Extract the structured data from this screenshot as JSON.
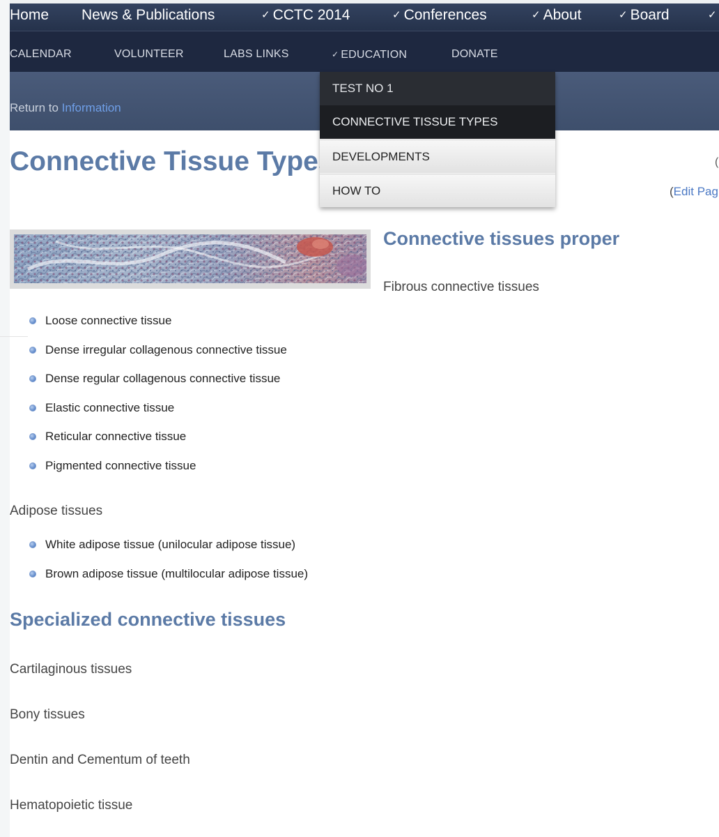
{
  "top_nav": {
    "items": [
      {
        "label": "Home",
        "chevron": false
      },
      {
        "label": "News & Publications",
        "chevron": false
      },
      {
        "label": "CCTC 2014",
        "chevron": true
      },
      {
        "label": "Conferences",
        "chevron": true
      },
      {
        "label": "About",
        "chevron": true
      },
      {
        "label": "Board",
        "chevron": true
      }
    ]
  },
  "sub_nav": {
    "items": [
      {
        "label": "CALENDAR"
      },
      {
        "label": "VOLUNTEER"
      },
      {
        "label": "LABS LINKS"
      },
      {
        "label": "EDUCATION",
        "chevron": true
      },
      {
        "label": "DONATE"
      }
    ]
  },
  "dropdown": {
    "items": [
      {
        "label": "TEST NO 1"
      },
      {
        "label": "CONNECTIVE TISSUE TYPES"
      },
      {
        "label": "DEVELOPMENTS"
      },
      {
        "label": "HOW TO"
      }
    ]
  },
  "breadcrumb": {
    "prefix": "Return to ",
    "link": "Information"
  },
  "page": {
    "title": "Connective Tissue Types",
    "edit_open": "(",
    "edit_link": "Edit Pag"
  },
  "content": {
    "proper_heading": "Connective tissues proper",
    "fibrous_label": "Fibrous connective tissues",
    "fibrous_list": [
      "Loose connective tissue",
      "Dense irregular collagenous connective tissue",
      "Dense regular collagenous connective tissue",
      "Elastic connective tissue",
      "Reticular connective tissue",
      "Pigmented connective tissue"
    ],
    "adipose_label": "Adipose tissues",
    "adipose_list": [
      "White adipose tissue (unilocular adipose tissue)",
      "Brown adipose tissue (multilocular adipose tissue)"
    ],
    "specialized_heading": "Specialized connective tissues",
    "specialized_items": [
      "Cartilaginous tissues",
      "Bony tissues",
      "Dentin and Cementum of teeth",
      "Hematopoietic tissue"
    ]
  },
  "colors": {
    "nav_bg": "#2c3a55",
    "subnav_bg": "#1e2840",
    "heading": "#5b7aa6",
    "link": "#6f9fe8"
  }
}
